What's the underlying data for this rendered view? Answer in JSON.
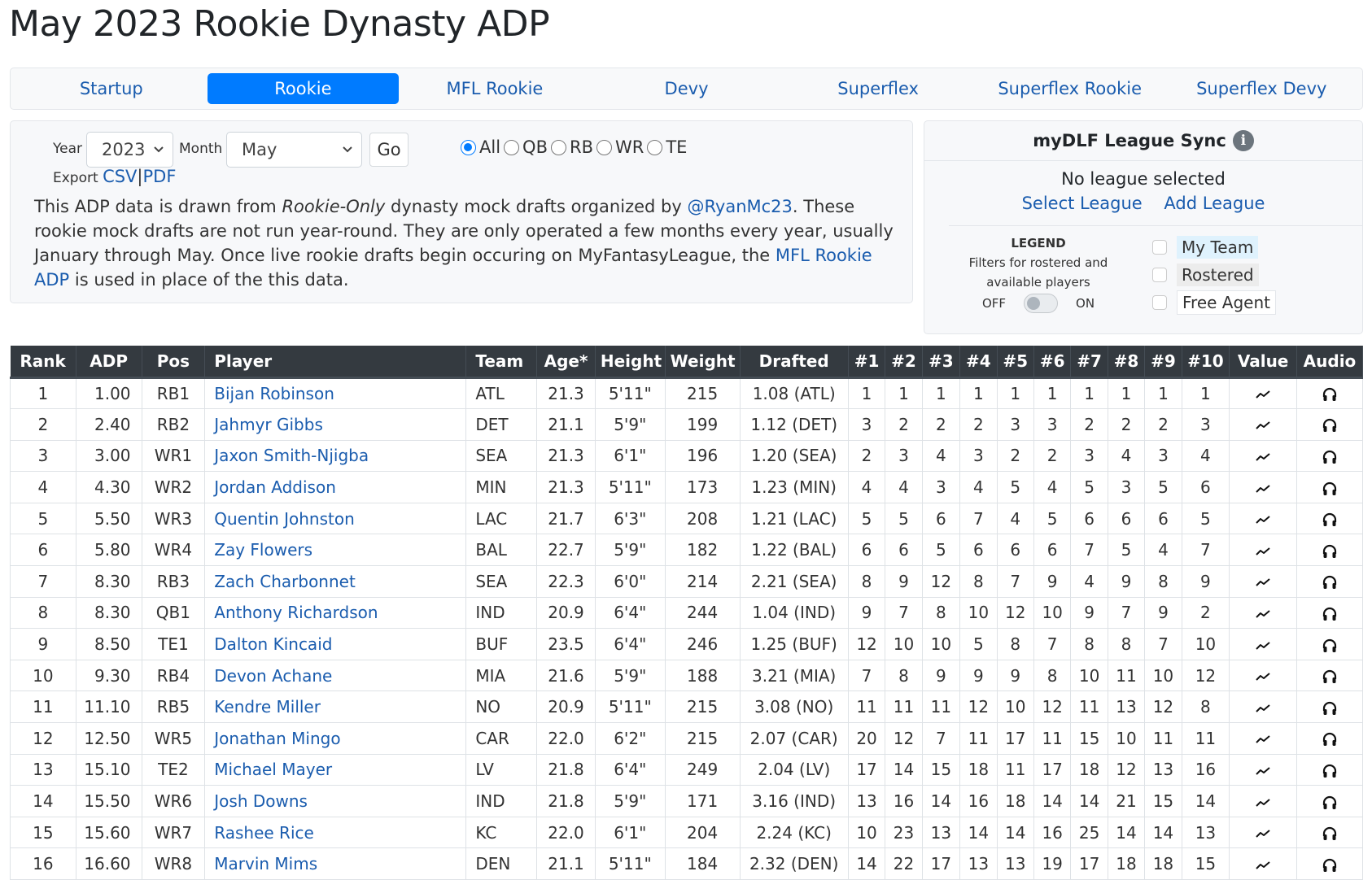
{
  "page": {
    "title": "May 2023 Rookie Dynasty ADP"
  },
  "tabs": [
    {
      "label": "Startup",
      "active": false
    },
    {
      "label": "Rookie",
      "active": true
    },
    {
      "label": "MFL Rookie",
      "active": false
    },
    {
      "label": "Devy",
      "active": false
    },
    {
      "label": "Superflex",
      "active": false
    },
    {
      "label": "Superflex Rookie",
      "active": false
    },
    {
      "label": "Superflex Devy",
      "active": false
    }
  ],
  "filters": {
    "year_label": "Year",
    "year_value": "2023",
    "month_label": "Month",
    "month_value": "May",
    "go_label": "Go",
    "export_label": "Export",
    "export_csv": "CSV",
    "export_sep": "|",
    "export_pdf": "PDF",
    "positions": [
      {
        "label": "All",
        "checked": true
      },
      {
        "label": "QB",
        "checked": false
      },
      {
        "label": "RB",
        "checked": false
      },
      {
        "label": "WR",
        "checked": false
      },
      {
        "label": "TE",
        "checked": false
      }
    ],
    "description": {
      "part1": "This ADP data is drawn from ",
      "italic": "Rookie-Only",
      "part2": " dynasty mock drafts organized by ",
      "link1": "@RyanMc23",
      "part3": ". These rookie mock drafts are not run year-round. They are only operated a few months every year, usually January through May. Once live rookie drafts begin occuring on MyFantasyLeague, the ",
      "link2": "MFL Rookie ADP",
      "part4": " is used in place of the this data."
    }
  },
  "sync": {
    "title": "myDLF League Sync",
    "info_icon": "i",
    "status": "No league selected",
    "select_league": "Select League",
    "add_league": "Add League",
    "legend_title": "LEGEND",
    "legend_desc_1": "Filters for rostered and",
    "legend_desc_2": "available players",
    "toggle_off": "OFF",
    "toggle_on": "ON",
    "toggle_state": "off",
    "checks": [
      {
        "label": "My Team",
        "checked": false
      },
      {
        "label": "Rostered",
        "checked": false
      },
      {
        "label": "Free Agent",
        "checked": false
      }
    ]
  },
  "table": {
    "headers": [
      "Rank",
      "ADP",
      "Pos",
      "Player",
      "Team",
      "Age*",
      "Height",
      "Weight",
      "Drafted",
      "#1",
      "#2",
      "#3",
      "#4",
      "#5",
      "#6",
      "#7",
      "#8",
      "#9",
      "#10",
      "Value",
      "Audio"
    ],
    "rows": [
      {
        "rank": "1",
        "adp": "1.00",
        "pos": "RB1",
        "player": "Bijan Robinson",
        "team": "ATL",
        "age": "21.3",
        "height": "5'11\"",
        "weight": "215",
        "drafted": "1.08 (ATL)",
        "picks": [
          "1",
          "1",
          "1",
          "1",
          "1",
          "1",
          "1",
          "1",
          "1",
          "1"
        ]
      },
      {
        "rank": "2",
        "adp": "2.40",
        "pos": "RB2",
        "player": "Jahmyr Gibbs",
        "team": "DET",
        "age": "21.1",
        "height": "5'9\"",
        "weight": "199",
        "drafted": "1.12 (DET)",
        "picks": [
          "3",
          "2",
          "2",
          "2",
          "3",
          "3",
          "2",
          "2",
          "2",
          "3"
        ]
      },
      {
        "rank": "3",
        "adp": "3.00",
        "pos": "WR1",
        "player": "Jaxon Smith-Njigba",
        "team": "SEA",
        "age": "21.3",
        "height": "6'1\"",
        "weight": "196",
        "drafted": "1.20 (SEA)",
        "picks": [
          "2",
          "3",
          "4",
          "3",
          "2",
          "2",
          "3",
          "4",
          "3",
          "4"
        ]
      },
      {
        "rank": "4",
        "adp": "4.30",
        "pos": "WR2",
        "player": "Jordan Addison",
        "team": "MIN",
        "age": "21.3",
        "height": "5'11\"",
        "weight": "173",
        "drafted": "1.23 (MIN)",
        "picks": [
          "4",
          "4",
          "3",
          "4",
          "5",
          "4",
          "5",
          "3",
          "5",
          "6"
        ]
      },
      {
        "rank": "5",
        "adp": "5.50",
        "pos": "WR3",
        "player": "Quentin Johnston",
        "team": "LAC",
        "age": "21.7",
        "height": "6'3\"",
        "weight": "208",
        "drafted": "1.21 (LAC)",
        "picks": [
          "5",
          "5",
          "6",
          "7",
          "4",
          "5",
          "6",
          "6",
          "6",
          "5"
        ]
      },
      {
        "rank": "6",
        "adp": "5.80",
        "pos": "WR4",
        "player": "Zay Flowers",
        "team": "BAL",
        "age": "22.7",
        "height": "5'9\"",
        "weight": "182",
        "drafted": "1.22 (BAL)",
        "picks": [
          "6",
          "6",
          "5",
          "6",
          "6",
          "6",
          "7",
          "5",
          "4",
          "7"
        ]
      },
      {
        "rank": "7",
        "adp": "8.30",
        "pos": "RB3",
        "player": "Zach Charbonnet",
        "team": "SEA",
        "age": "22.3",
        "height": "6'0\"",
        "weight": "214",
        "drafted": "2.21 (SEA)",
        "picks": [
          "8",
          "9",
          "12",
          "8",
          "7",
          "9",
          "4",
          "9",
          "8",
          "9"
        ]
      },
      {
        "rank": "8",
        "adp": "8.30",
        "pos": "QB1",
        "player": "Anthony Richardson",
        "team": "IND",
        "age": "20.9",
        "height": "6'4\"",
        "weight": "244",
        "drafted": "1.04 (IND)",
        "picks": [
          "9",
          "7",
          "8",
          "10",
          "12",
          "10",
          "9",
          "7",
          "9",
          "2"
        ]
      },
      {
        "rank": "9",
        "adp": "8.50",
        "pos": "TE1",
        "player": "Dalton Kincaid",
        "team": "BUF",
        "age": "23.5",
        "height": "6'4\"",
        "weight": "246",
        "drafted": "1.25 (BUF)",
        "picks": [
          "12",
          "10",
          "10",
          "5",
          "8",
          "7",
          "8",
          "8",
          "7",
          "10"
        ]
      },
      {
        "rank": "10",
        "adp": "9.30",
        "pos": "RB4",
        "player": "Devon Achane",
        "team": "MIA",
        "age": "21.6",
        "height": "5'9\"",
        "weight": "188",
        "drafted": "3.21 (MIA)",
        "picks": [
          "7",
          "8",
          "9",
          "9",
          "9",
          "8",
          "10",
          "11",
          "10",
          "12"
        ]
      },
      {
        "rank": "11",
        "adp": "11.10",
        "pos": "RB5",
        "player": "Kendre Miller",
        "team": "NO",
        "age": "20.9",
        "height": "5'11\"",
        "weight": "215",
        "drafted": "3.08 (NO)",
        "picks": [
          "11",
          "11",
          "11",
          "12",
          "10",
          "12",
          "11",
          "13",
          "12",
          "8"
        ]
      },
      {
        "rank": "12",
        "adp": "12.50",
        "pos": "WR5",
        "player": "Jonathan Mingo",
        "team": "CAR",
        "age": "22.0",
        "height": "6'2\"",
        "weight": "215",
        "drafted": "2.07 (CAR)",
        "picks": [
          "20",
          "12",
          "7",
          "11",
          "17",
          "11",
          "15",
          "10",
          "11",
          "11"
        ]
      },
      {
        "rank": "13",
        "adp": "15.10",
        "pos": "TE2",
        "player": "Michael Mayer",
        "team": "LV",
        "age": "21.8",
        "height": "6'4\"",
        "weight": "249",
        "drafted": "2.04 (LV)",
        "picks": [
          "17",
          "14",
          "15",
          "18",
          "11",
          "17",
          "18",
          "12",
          "13",
          "16"
        ]
      },
      {
        "rank": "14",
        "adp": "15.50",
        "pos": "WR6",
        "player": "Josh Downs",
        "team": "IND",
        "age": "21.8",
        "height": "5'9\"",
        "weight": "171",
        "drafted": "3.16 (IND)",
        "picks": [
          "13",
          "16",
          "14",
          "16",
          "18",
          "14",
          "14",
          "21",
          "15",
          "14"
        ]
      },
      {
        "rank": "15",
        "adp": "15.60",
        "pos": "WR7",
        "player": "Rashee Rice",
        "team": "KC",
        "age": "22.0",
        "height": "6'1\"",
        "weight": "204",
        "drafted": "2.24 (KC)",
        "picks": [
          "10",
          "23",
          "13",
          "14",
          "14",
          "16",
          "25",
          "14",
          "14",
          "13"
        ]
      },
      {
        "rank": "16",
        "adp": "16.60",
        "pos": "WR8",
        "player": "Marvin Mims",
        "team": "DEN",
        "age": "21.1",
        "height": "5'11\"",
        "weight": "184",
        "drafted": "2.32 (DEN)",
        "picks": [
          "14",
          "22",
          "17",
          "13",
          "13",
          "19",
          "17",
          "18",
          "18",
          "15"
        ]
      }
    ],
    "value_icon": "trend-line-icon",
    "audio_icon": "headphones-icon"
  },
  "colors": {
    "accent": "#007bff",
    "link": "#1a5cae",
    "table_header_bg": "#343a40",
    "panel_bg": "#f7f8fa",
    "my_team_bg": "#dff2fd",
    "rostered_bg": "#ececec"
  }
}
